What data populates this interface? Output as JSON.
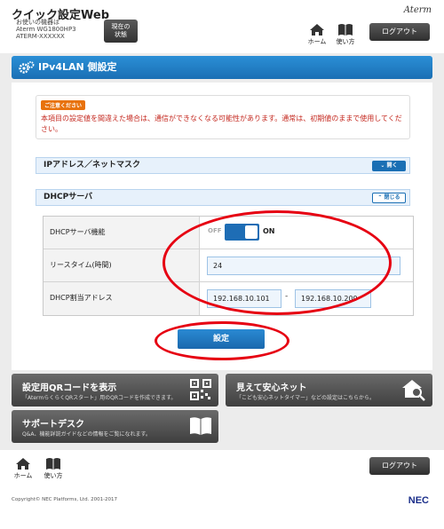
{
  "header": {
    "app_title": "クイック設定Web",
    "device_label": "お使いの機器は",
    "device_model": "Aterm WG1800HP3",
    "device_id": "ATERM-XXXXXX",
    "status_button": "現在の\n状態",
    "brand": "Aterm",
    "home_label": "ホーム",
    "help_label": "使い方",
    "logout_label": "ログアウト"
  },
  "section": {
    "title": "IPv4LAN 側設定"
  },
  "caution": {
    "badge": "ご注意ください",
    "text": "本項目の設定値を間違えた場合は、通信ができなくなる可能性があります。通常は、初期値のままで使用してください。"
  },
  "accordions": {
    "ip": {
      "label": "IPアドレス／ネットマスク",
      "button": "開く"
    },
    "dhcp": {
      "label": "DHCPサーバ",
      "button": "閉じる"
    }
  },
  "form": {
    "dhcp_function": {
      "label": "DHCPサーバ機能",
      "off": "OFF",
      "on": "ON",
      "state": "on"
    },
    "lease_time": {
      "label": "リースタイム(時間)",
      "value": "24"
    },
    "dhcp_range": {
      "label": "DHCP割当アドレス",
      "start": "192.168.10.101",
      "separator": "-",
      "end": "192.168.10.200"
    }
  },
  "submit_label": "設定",
  "cards": {
    "qr": {
      "title": "設定用QRコードを表示",
      "desc": "「AtermらくらくQRスタート」用のQRコードを作成できます。"
    },
    "safe": {
      "title": "見えて安心ネット",
      "desc": "「こども安心ネットタイマー」などの設定はこちらから。"
    },
    "support": {
      "title": "サポートデスク",
      "desc": "Q&A、機能詳説ガイドなどの情報をご覧になれます。"
    }
  },
  "footer": {
    "home_label": "ホーム",
    "help_label": "使い方",
    "logout_label": "ログアウト",
    "copyright": "Copyright© NEC Platforms, Ltd. 2001-2017",
    "logo": "NEC"
  },
  "colors": {
    "primary_blue": "#1a6fb4",
    "caution_orange": "#e8720c",
    "caution_text_red": "#c4281f",
    "annotation_red": "#e60012"
  }
}
